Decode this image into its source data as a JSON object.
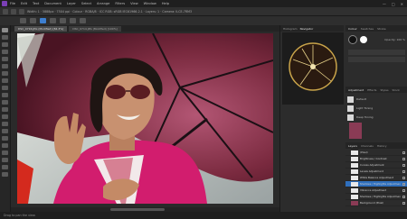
{
  "menubar": {
    "items": [
      "File",
      "Edit",
      "Text",
      "Document",
      "Layer",
      "Select",
      "Arrange",
      "Filters",
      "View",
      "Window",
      "Help"
    ],
    "window_controls": [
      "—",
      "□",
      "✕"
    ]
  },
  "contextbar": {
    "text": "Width: 1 · 5888px · 7504 ppi · Colour · RGBA/8 · ICC RGB: sRGB IEC61966-2.1 · Layers: 1 · Camera: ILCE-7RM3"
  },
  "doc_tabs": [
    {
      "label": "DSC_0716.JPG (Modified) [84.3%]",
      "active": true
    },
    {
      "label": "DSC_0714.JPG (Modified) [100%]",
      "active": false
    }
  ],
  "status": {
    "text": "Drag to pan the view."
  },
  "right_panel": {
    "navigator_tabs": [
      "Histogram",
      "Navigator"
    ],
    "color_tabs": [
      "Colour",
      "Swatches",
      "Stroke"
    ],
    "opacity_label": "Opacity: 100 %",
    "adjustment_tabs": [
      "Adjustment",
      "Effects",
      "Styles",
      "Stock"
    ],
    "styles": [
      "Default",
      "Light Toning",
      "Deep Toning"
    ],
    "layers_tabs": [
      "Layers",
      "Channels",
      "History"
    ],
    "layers": [
      {
        "name": "(Pixel)",
        "selected": false
      },
      {
        "name": "Brightness / Contrast",
        "selected": false
      },
      {
        "name": "Curves Adjustment",
        "selected": false
      },
      {
        "name": "Levels Adjustment",
        "selected": false
      },
      {
        "name": "White Balance Adjustment",
        "selected": false
      },
      {
        "name": "Shadows / Highlights Adjustment",
        "selected": true
      },
      {
        "name": "Vibrance Adjustment",
        "selected": false
      },
      {
        "name": "Shadows / Highlights Adjustment",
        "selected": false
      },
      {
        "name": "Background (Pixel)",
        "selected": false
      }
    ]
  },
  "icons": {
    "app": "affinity-photo-icon",
    "navigator_preview": "umbrella-thumbnail"
  },
  "colors": {
    "accent": "#2f6fbd",
    "umbrella": "#7a2a3f",
    "jacket": "#d21d6e"
  }
}
